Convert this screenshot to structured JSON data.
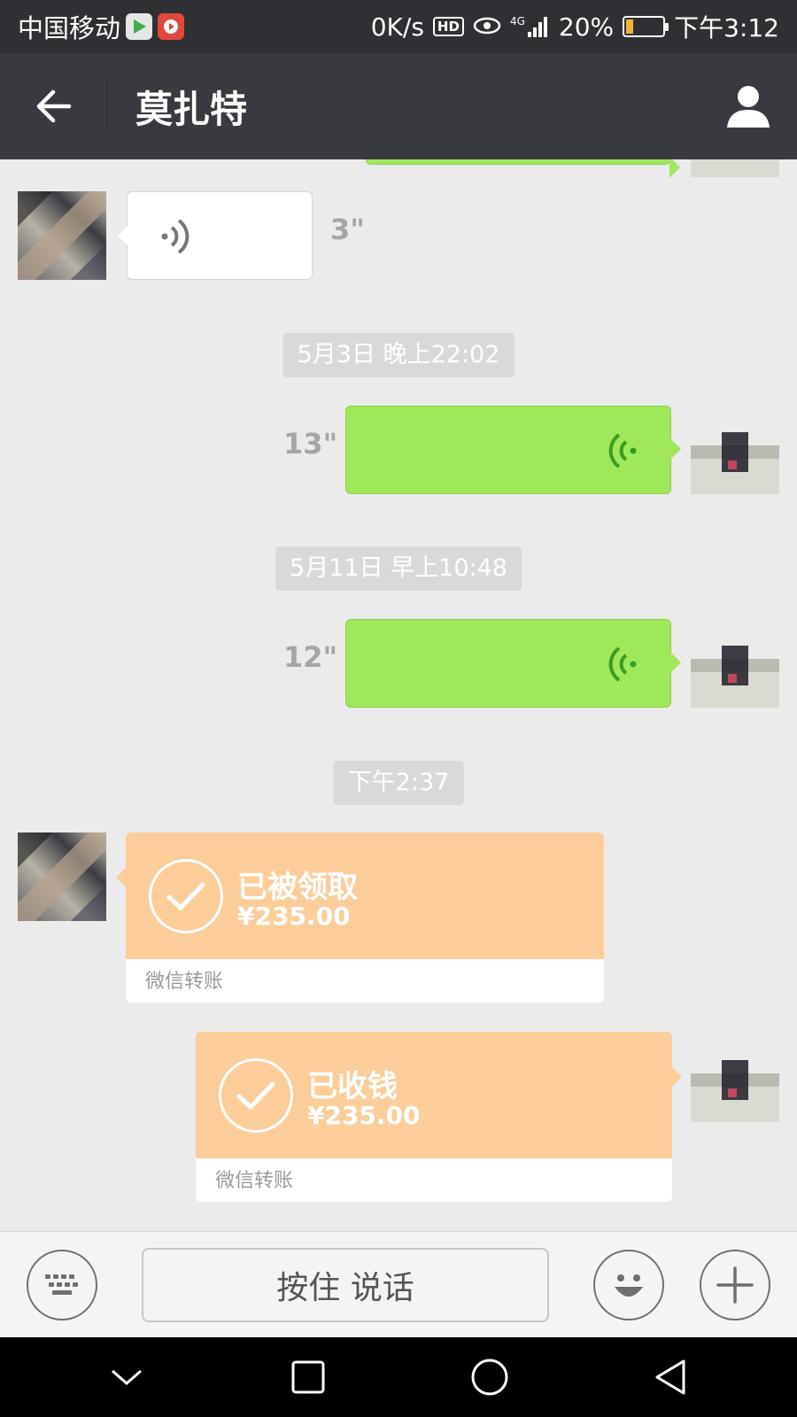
{
  "status_bar": {
    "carrier": "中国移动",
    "net_speed": "0K/s",
    "hd_label": "HD",
    "signal_label": "4G",
    "battery_percent": "20%",
    "battery_level": 0.2,
    "time": "下午3:12"
  },
  "header": {
    "title": "莫扎特",
    "back_icon": "arrow-left-icon",
    "profile_icon": "person-icon"
  },
  "messages": {
    "voice_1": {
      "side": "left",
      "duration": "3\""
    },
    "time_1": "5月3日 晚上22:02",
    "voice_2": {
      "side": "right",
      "duration": "13\""
    },
    "time_2": "5月11日 早上10:48",
    "voice_3": {
      "side": "right",
      "duration": "12\""
    },
    "time_3": "下午2:37",
    "transfer_1": {
      "side": "left",
      "status": "已被领取",
      "amount": "¥235.00",
      "footer": "微信转账"
    },
    "transfer_2": {
      "side": "right",
      "status": "已收钱",
      "amount": "¥235.00",
      "footer": "微信转账"
    }
  },
  "input_bar": {
    "keyboard_icon": "keyboard-icon",
    "hold_to_talk_label": "按住 说话",
    "emoji_icon": "smiley-icon",
    "plus_icon": "plus-icon"
  },
  "nav_bar": {
    "icons": [
      "chevron-down-icon",
      "square-icon",
      "circle-icon",
      "triangle-back-icon"
    ]
  },
  "colors": {
    "status_bar_bg": "#2f3034",
    "title_bar_bg": "#393a3f",
    "chat_bg": "#ebebeb",
    "bubble_green": "#a0e75a",
    "transfer_orange": "#fdcd99"
  }
}
